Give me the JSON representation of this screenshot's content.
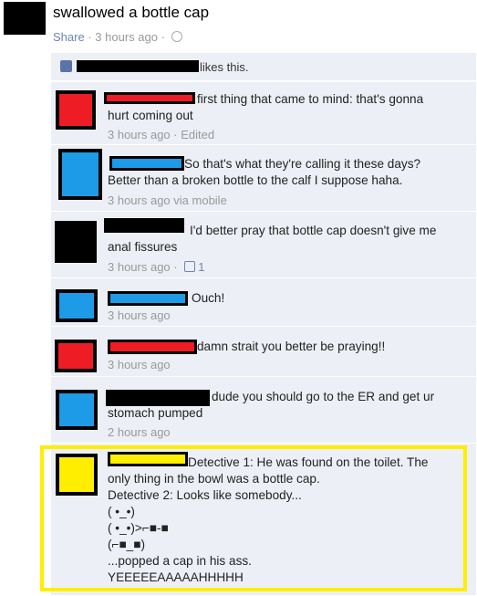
{
  "post": {
    "text": "swallowed a bottle cap",
    "share_label": "Share",
    "time": "3 hours ago"
  },
  "likes": {
    "text": "likes this."
  },
  "comments": [
    {
      "text": "first thing that came to mind: that's gonna\nhurt coming out",
      "time": "3 hours ago",
      "suffix": "Edited"
    },
    {
      "text": "So that's what they're calling it these days?\nBetter than a broken bottle to the calf I suppose haha.",
      "time": "3 hours ago via mobile"
    },
    {
      "text": "I'd better pray that bottle cap doesn't give me\nanal fissures",
      "time": "3 hours ago",
      "likes": "1"
    },
    {
      "text": "Ouch!",
      "time": "3 hours ago"
    },
    {
      "text": "damn strait you better be praying!!",
      "time": "3 hours ago"
    },
    {
      "text": "dude you should go to the ER and get ur\nstomach pumped",
      "time": "2 hours ago"
    },
    {
      "text": "Detective 1: He was found on the toilet. The\nonly thing in the bowl was a bottle cap.\nDetective 2: Looks like somebody...\n( •_•)\n( •_•)>⌐■-■\n(⌐■_■)\n...popped a cap in his ass.\nYEEEEEAAAAAHHHHH"
    }
  ],
  "colors": {
    "red": "#ee1c24",
    "blue": "#1d9be6",
    "yellow": "#ffee00",
    "link": "#6d84b4",
    "thread_bg": "#eceff5"
  }
}
